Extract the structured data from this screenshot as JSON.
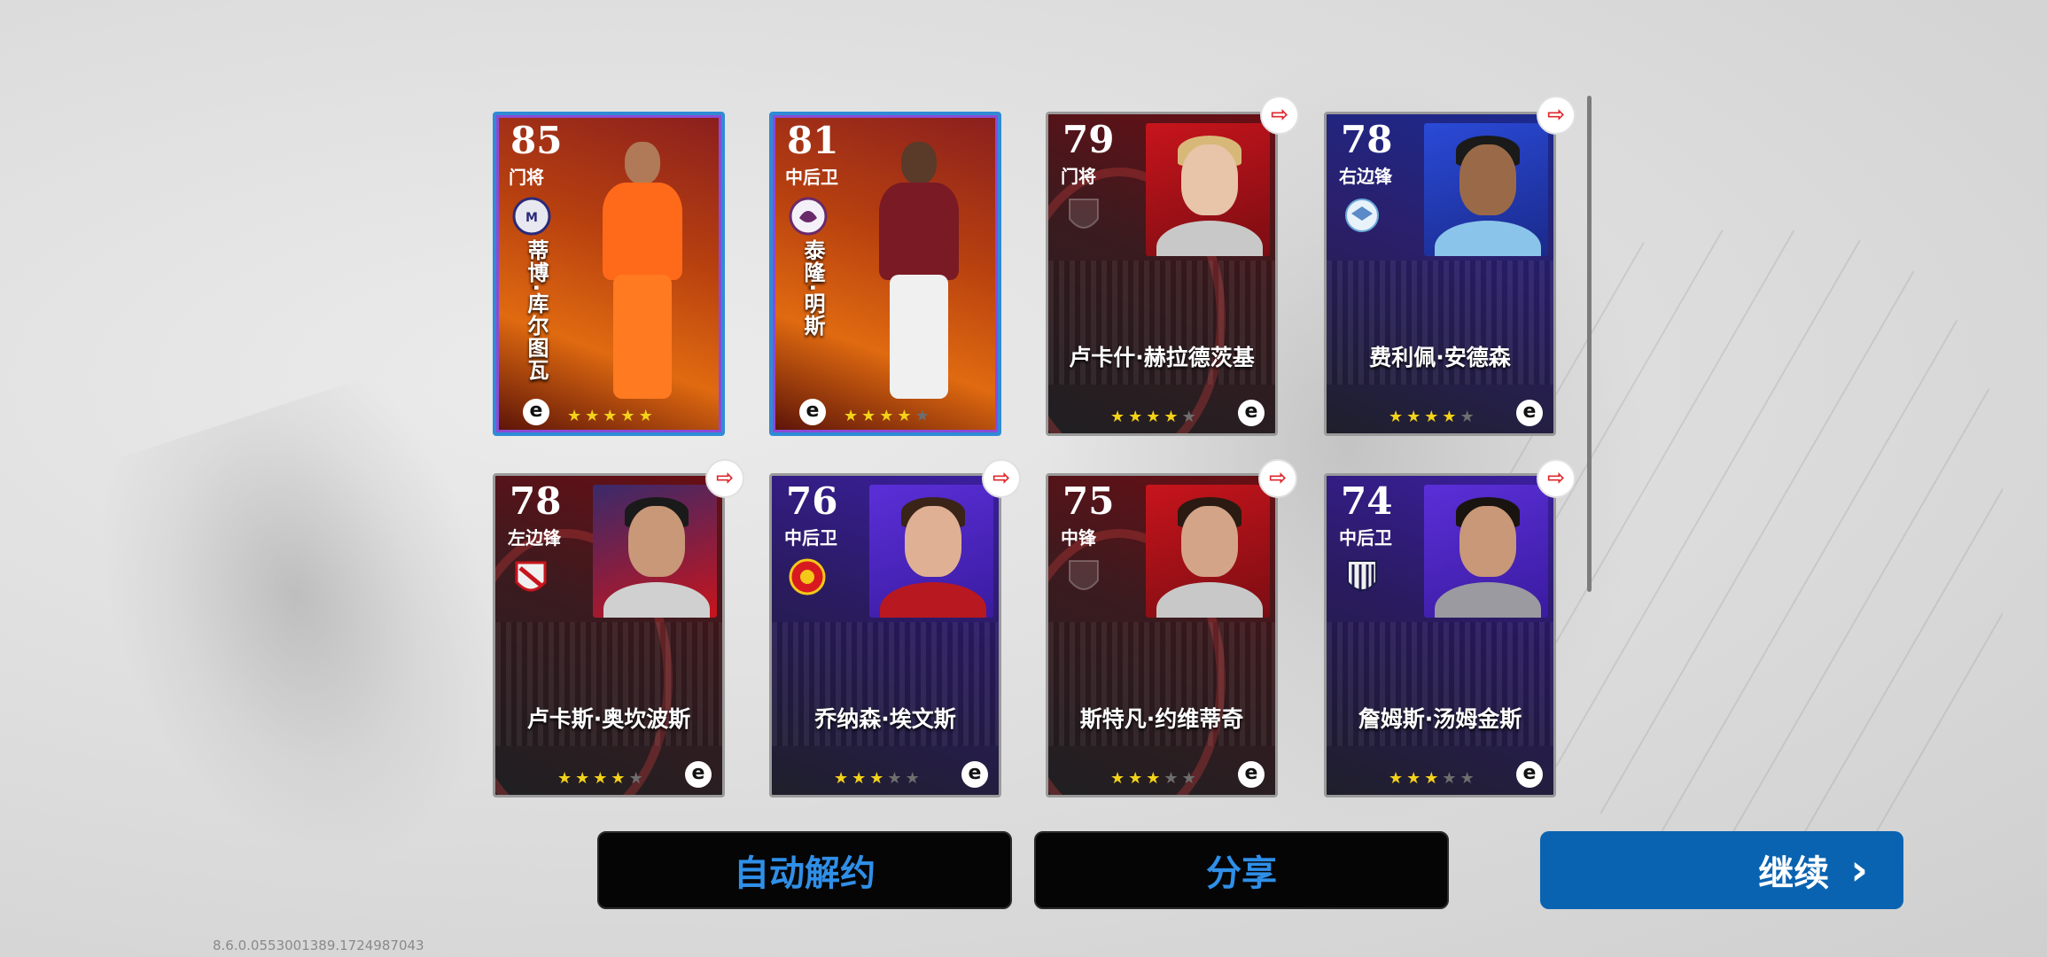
{
  "cards": [
    {
      "rating": "85",
      "position": "门将",
      "name": "蒂博·库尔图瓦",
      "stars": 5,
      "filled": 5,
      "theme": "orange",
      "featured": true
    },
    {
      "rating": "81",
      "position": "中后卫",
      "name": "泰隆·明斯",
      "stars": 5,
      "filled": 4,
      "theme": "orange",
      "featured": true
    },
    {
      "rating": "79",
      "position": "门将",
      "name": "卢卡什·赫拉德茨基",
      "stars": 5,
      "filled": 4,
      "theme": "red",
      "featured": false
    },
    {
      "rating": "78",
      "position": "右边锋",
      "name": "费利佩·安德森",
      "stars": 5,
      "filled": 4,
      "theme": "blue",
      "featured": false
    },
    {
      "rating": "78",
      "position": "左边锋",
      "name": "卢卡斯·奥坎波斯",
      "stars": 5,
      "filled": 4,
      "theme": "red",
      "featured": false
    },
    {
      "rating": "76",
      "position": "中后卫",
      "name": "乔纳森·埃文斯",
      "stars": 5,
      "filled": 3,
      "theme": "purple",
      "featured": false
    },
    {
      "rating": "75",
      "position": "中锋",
      "name": "斯特凡·约维蒂奇",
      "stars": 5,
      "filled": 3,
      "theme": "red",
      "featured": false
    },
    {
      "rating": "74",
      "position": "中后卫",
      "name": "詹姆斯·汤姆金斯",
      "stars": 5,
      "filled": 3,
      "theme": "purple",
      "featured": false
    }
  ],
  "buttons": {
    "auto_release": "自动解约",
    "share": "分享",
    "continue": "继续"
  },
  "version": "8.6.0.0553001389.1724987043",
  "icons": {
    "release": "release-contract-icon",
    "efootball": "efootball-logo-icon",
    "continue": "chevron-right-icon"
  },
  "colors": {
    "accent_blue": "#0a63b0",
    "button_text": "#2f8fe8",
    "star": "#f3d21a",
    "release_red": "#e0282c"
  }
}
